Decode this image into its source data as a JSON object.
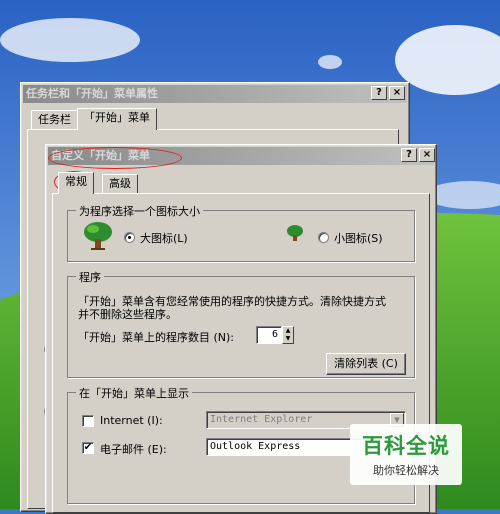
{
  "back_window": {
    "title": "任务栏和「开始」菜单属性",
    "help_btn": "?",
    "close_btn": "×",
    "tabs": [
      "任务栏",
      "「开始」菜单"
    ]
  },
  "dialog": {
    "title": "自定义「开始」菜单",
    "help_btn": "?",
    "close_btn": "×",
    "tabs": [
      "常规",
      "高级"
    ],
    "icon_size_group": {
      "label": "为程序选择一个图标大小",
      "large_label": "大图标(L)",
      "small_label": "小图标(S)",
      "selected": "large"
    },
    "programs_group": {
      "label": "程序",
      "description_line1": "「开始」菜单含有您经常使用的程序的快捷方式。清除快捷方式",
      "description_line2": "并不删除这些程序。",
      "count_label": "「开始」菜单上的程序数目 (N):",
      "count_value": "6",
      "clear_button": "清除列表 (C)"
    },
    "show_group": {
      "label": "在「开始」菜单上显示",
      "internet_label": "Internet (I):",
      "internet_checked": false,
      "internet_value": "Internet Explorer",
      "email_label": "电子邮件 (E):",
      "email_checked": true,
      "email_value": "Outlook Express"
    }
  },
  "watermark": {
    "title": "百科全说",
    "subtitle": "助你轻松解决"
  }
}
